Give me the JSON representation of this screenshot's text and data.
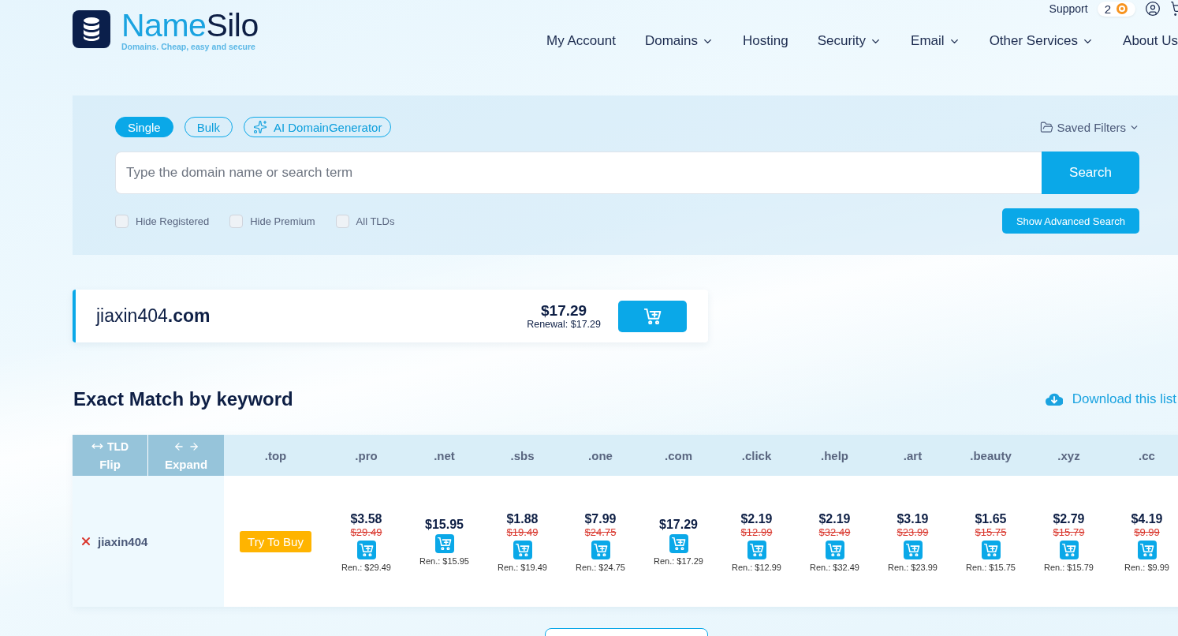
{
  "header": {
    "brand_first": "Name",
    "brand_second": "Silo",
    "tagline": "Domains. Cheap, easy and secure",
    "support": "Support",
    "notifications": "2",
    "nav": [
      {
        "label": "My Account",
        "dropdown": false
      },
      {
        "label": "Domains",
        "dropdown": true
      },
      {
        "label": "Hosting",
        "dropdown": false
      },
      {
        "label": "Security",
        "dropdown": true
      },
      {
        "label": "Email",
        "dropdown": true
      },
      {
        "label": "Other Services",
        "dropdown": true
      },
      {
        "label": "About Us",
        "dropdown": false
      }
    ]
  },
  "search": {
    "modes": [
      {
        "label": "Single",
        "selected": true,
        "kind": "plain"
      },
      {
        "label": "Bulk",
        "selected": false,
        "kind": "plain"
      },
      {
        "label": "AI DomainGenerator",
        "selected": false,
        "kind": "ai"
      }
    ],
    "saved_filters": "Saved Filters",
    "placeholder": "Type the domain name or search term",
    "button": "Search",
    "filters": [
      {
        "label": "Hide Registered",
        "checked": false
      },
      {
        "label": "Hide Premium",
        "checked": false
      },
      {
        "label": "All TLDs",
        "checked": false
      }
    ],
    "advanced_button": "Show Advanced Search"
  },
  "result": {
    "domain": "jiaxin404**.com**",
    "price": "$17.29",
    "renewal": "Renewal: $17.29"
  },
  "exact_match": {
    "title": "Exact Match by keyword",
    "download": "Download this list",
    "controls": [
      {
        "kind": "flip",
        "label": "TLD",
        "caption": "Flip"
      },
      {
        "kind": "expand",
        "caption": "Expand"
      }
    ],
    "columns": [
      ".top",
      ".pro",
      ".net",
      ".sbs",
      ".one",
      ".com",
      ".click",
      ".help",
      ".art",
      ".beauty",
      ".xyz",
      ".cc"
    ],
    "rows": [
      {
        "name": "jiaxin404",
        "available": false,
        "cells": [
          {
            "kind": "try",
            "label": "Try To Buy"
          },
          {
            "kind": "price",
            "price": "$3.58",
            "original": "$29.49",
            "renewal": "Ren.: $29.49"
          },
          {
            "kind": "price",
            "price": "$15.95",
            "renewal": "Ren.: $15.95"
          },
          {
            "kind": "price",
            "price": "$1.88",
            "original": "$19.49",
            "renewal": "Ren.: $19.49"
          },
          {
            "kind": "price",
            "price": "$7.99",
            "original": "$24.75",
            "renewal": "Ren.: $24.75"
          },
          {
            "kind": "price",
            "price": "$17.29",
            "renewal": "Ren.: $17.29"
          },
          {
            "kind": "price",
            "price": "$2.19",
            "original": "$12.99",
            "renewal": "Ren.: $12.99"
          },
          {
            "kind": "price",
            "price": "$2.19",
            "original": "$32.49",
            "renewal": "Ren.: $32.49"
          },
          {
            "kind": "price",
            "price": "$3.19",
            "original": "$23.99",
            "renewal": "Ren.: $23.99"
          },
          {
            "kind": "price",
            "price": "$1.65",
            "original": "$15.75",
            "renewal": "Ren.: $15.75"
          },
          {
            "kind": "price",
            "price": "$2.79",
            "original": "$15.79",
            "renewal": "Ren.: $15.79"
          },
          {
            "kind": "price",
            "price": "$4.19",
            "original": "$9.99",
            "renewal": "Ren.: $9.99"
          }
        ]
      }
    ]
  }
}
